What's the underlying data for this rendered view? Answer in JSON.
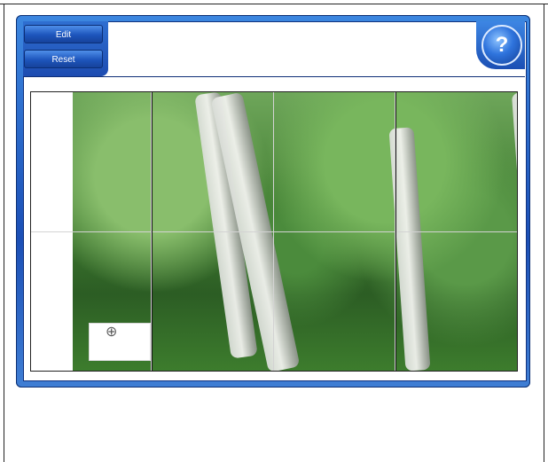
{
  "toolbar": {
    "edit_label": "Edit",
    "reset_label": "Reset",
    "help_label": "?"
  }
}
